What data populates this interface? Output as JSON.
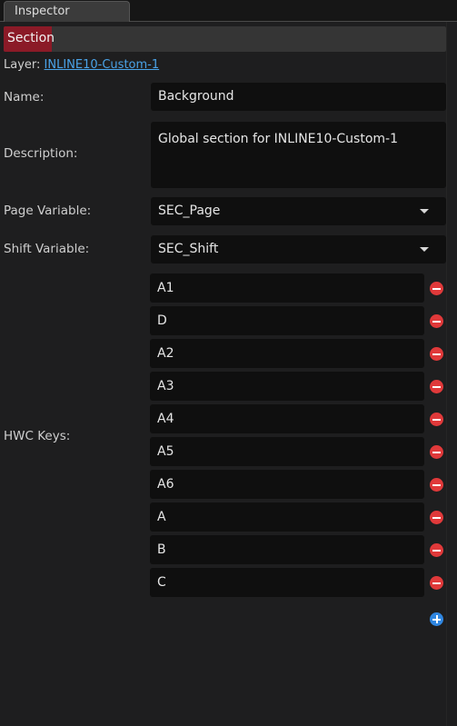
{
  "tab": {
    "label": "Inspector"
  },
  "section": {
    "badge": "Section"
  },
  "layer": {
    "label": "Layer:",
    "link": "INLINE10-Custom-1"
  },
  "fields": {
    "name": {
      "label": "Name:",
      "value": "Background"
    },
    "description": {
      "label": "Description:",
      "value": "Global section for INLINE10-Custom-1"
    },
    "page_variable": {
      "label": "Page Variable:",
      "value": "SEC_Page"
    },
    "shift_variable": {
      "label": "Shift Variable:",
      "value": "SEC_Shift"
    }
  },
  "hwc_keys": {
    "label": "HWC Keys:",
    "keys": [
      "A1",
      "D",
      "A2",
      "A3",
      "A4",
      "A5",
      "A6",
      "A",
      "B",
      "C"
    ]
  },
  "colors": {
    "section_badge": "#8b1a27",
    "link": "#4aa3e8",
    "remove": "#e0393a",
    "add": "#2f86e0"
  }
}
